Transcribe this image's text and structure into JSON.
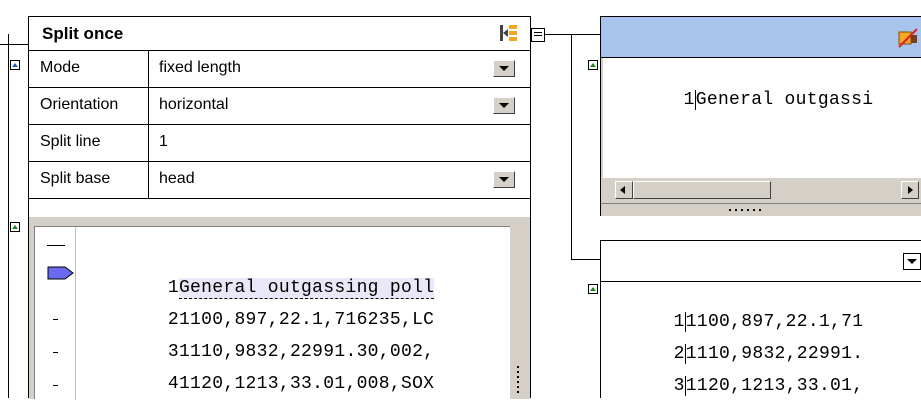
{
  "split_component": {
    "title": "Split once",
    "properties": [
      {
        "name": "Mode",
        "value": "fixed length",
        "has_dropdown": true
      },
      {
        "name": "Orientation",
        "value": "horizontal",
        "has_dropdown": true
      },
      {
        "name": "Split line",
        "value": "1",
        "has_dropdown": false
      },
      {
        "name": "Split base",
        "value": "head",
        "has_dropdown": true
      }
    ],
    "source_lines": [
      {
        "num": "1",
        "text": "General outgassing poll"
      },
      {
        "num": "2",
        "text": "1100,897,22.1,716235,LC"
      },
      {
        "num": "3",
        "text": "1110,9832,22991.30,002,"
      },
      {
        "num": "4",
        "text": "1120,1213,33.01,008,SOX"
      }
    ]
  },
  "head_output": {
    "lines": [
      {
        "num": "1",
        "text": "General outgassi"
      }
    ]
  },
  "tail_output": {
    "lines": [
      {
        "num": "1",
        "text": "1100,897,22.1,71"
      },
      {
        "num": "2",
        "text": "1110,9832,22991."
      },
      {
        "num": "3",
        "text": "1120,1213,33.01,"
      }
    ]
  },
  "icons": {
    "split_menu": "split-menu-icon",
    "tool": "tool-icon"
  },
  "colors": {
    "header_blue": "#a8c4ec",
    "line_highlight": "#e8e8f8",
    "marker_blue": "#1e5fc8",
    "marker_green": "#1a8a1a",
    "accent_orange": "#f5a623"
  }
}
